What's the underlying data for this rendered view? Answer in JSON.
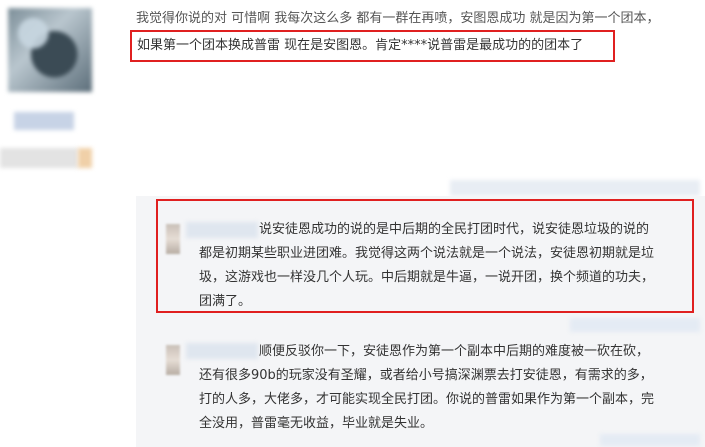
{
  "main_comment": {
    "line1": "我觉得你说的对 可惜啊 我每次这么多 都有一群在再喷，安图恩成功 就是因为第一个团本，",
    "line2": "如果第一个团本换成普雷 现在是安图恩。肯定****说普雷是最成功的的团本了"
  },
  "reply1": {
    "lines": [
      "说安徒恩成功的说的是中后期的全民打团时代，说安徒恩垃圾的说的",
      "都是初期某些职业进团难。我觉得这两个说法就是一个说法，安徒恩初期就是垃",
      "圾，这游戏也一样没几个人玩。中后期就是牛逼，一说开团，换个频道的功夫，",
      "团满了。"
    ]
  },
  "reply2": {
    "lines": [
      "顺便反驳你一下，安徒恩作为第一个副本中后期的难度被一砍在砍，",
      "还有很多90b的玩家没有圣耀，或者给小号搞深渊票去打安徒恩，有需求的多，",
      "打的人多，大佬多，才可能实现全民打团。你说的普雷如果作为第一个副本，完",
      "全没用，普雷毫无收益，毕业就是失业。"
    ]
  },
  "colors": {
    "highlight": "#e02020",
    "reply_background": "#f4f5f7",
    "text": "#333333"
  }
}
